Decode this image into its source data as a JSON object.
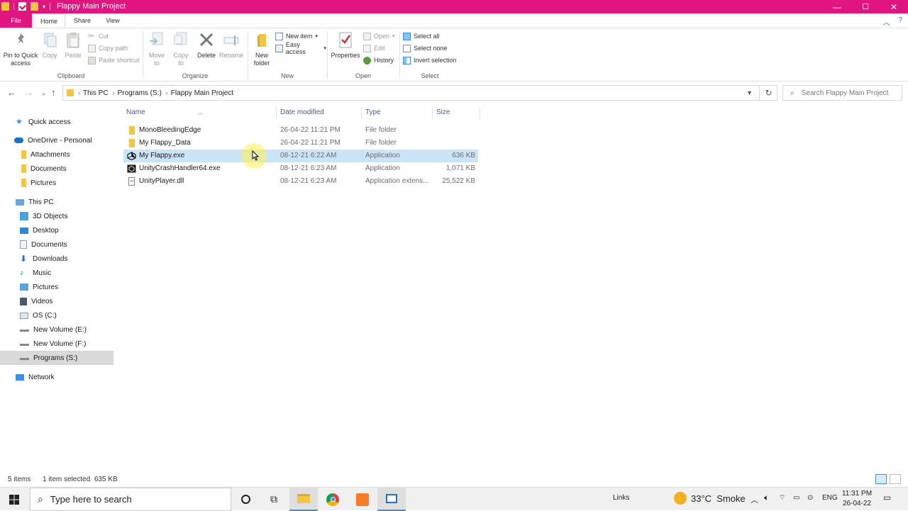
{
  "window": {
    "title": "Flappy Main Project",
    "controls": {
      "minimize": "—",
      "maximize": "☐",
      "close": "✕"
    }
  },
  "ribbon_tabs": [
    "File",
    "Home",
    "Share",
    "View"
  ],
  "ribbon": {
    "clipboard": {
      "label": "Clipboard",
      "pin": "Pin to Quick access",
      "copy": "Copy",
      "paste": "Paste",
      "cut": "Cut",
      "copy_path": "Copy path",
      "paste_shortcut": "Paste shortcut"
    },
    "organize": {
      "label": "Organize",
      "move_to": "Move to",
      "copy_to": "Copy to",
      "delete": "Delete",
      "rename": "Rename"
    },
    "new": {
      "label": "New",
      "new_folder": "New folder",
      "new_item": "New item",
      "easy_access": "Easy access"
    },
    "open": {
      "label": "Open",
      "properties": "Properties",
      "open": "Open",
      "edit": "Edit",
      "history": "History"
    },
    "select": {
      "label": "Select",
      "select_all": "Select all",
      "select_none": "Select none",
      "invert_selection": "Invert selection"
    }
  },
  "breadcrumb": [
    "This PC",
    "Programs (S:)",
    "Flappy Main Project"
  ],
  "search": {
    "placeholder": "Search Flappy Main Project"
  },
  "nav_pane": {
    "quick_access": "Quick access",
    "onedrive": "OneDrive - Personal",
    "onedrive_items": [
      "Attachments",
      "Documents",
      "Pictures"
    ],
    "this_pc": "This PC",
    "this_pc_items": [
      "3D Objects",
      "Desktop",
      "Documents",
      "Downloads",
      "Music",
      "Pictures",
      "Videos",
      "OS (C:)",
      "New Volume (E:)",
      "New Volume (F:)",
      "Programs (S:)"
    ],
    "network": "Network"
  },
  "columns": {
    "name": "Name",
    "date": "Date modified",
    "type": "Type",
    "size": "Size"
  },
  "files": [
    {
      "name": "MonoBleedingEdge",
      "date": "26-04-22 11:21 PM",
      "type": "File folder",
      "size": "",
      "icon": "folder-icon"
    },
    {
      "name": "My Flappy_Data",
      "date": "26-04-22 11:21 PM",
      "type": "File folder",
      "size": "",
      "icon": "folder-icon"
    },
    {
      "name": "My Flappy.exe",
      "date": "08-12-21 6:22 AM",
      "type": "Application",
      "size": "636 KB",
      "icon": "unity-app-icon"
    },
    {
      "name": "UnityCrashHandler64.exe",
      "date": "08-12-21 6:23 AM",
      "type": "Application",
      "size": "1,071 KB",
      "icon": "unity-crash-icon"
    },
    {
      "name": "UnityPlayer.dll",
      "date": "08-12-21 6:23 AM",
      "type": "Application extens...",
      "size": "25,522 KB",
      "icon": "dll-icon"
    }
  ],
  "status": {
    "items": "5 items",
    "selected": "1 item selected  635 KB"
  },
  "taskbar": {
    "search_placeholder": "Type here to search",
    "links": "Links",
    "weather": "33°C  Smoke",
    "lang": "ENG",
    "time": "11:31 PM",
    "date": "26-04-22"
  },
  "colors": {
    "accent": "#e0157f",
    "selection": "#cce4f7",
    "nav_selected": "#d9d9d9"
  }
}
